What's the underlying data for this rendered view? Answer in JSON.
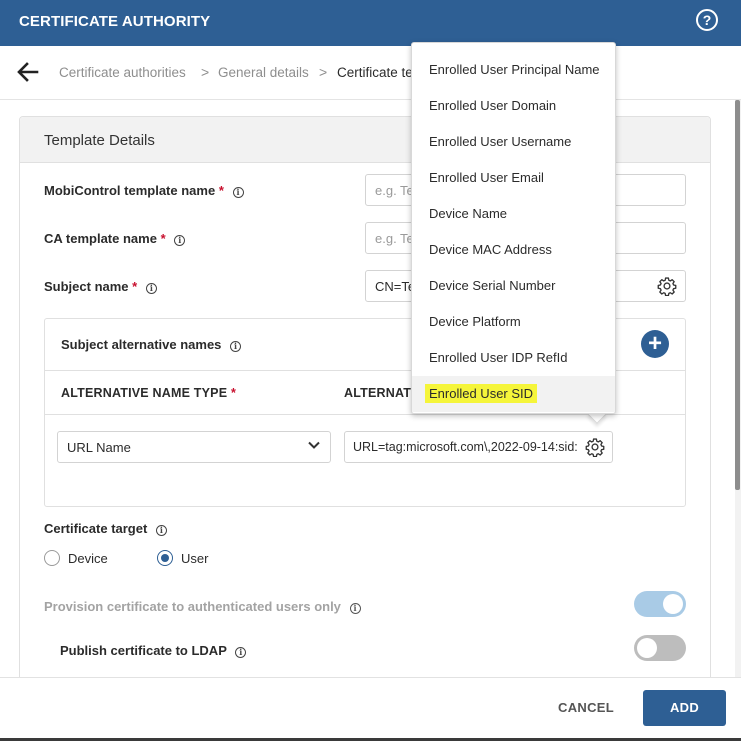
{
  "header": {
    "title": "CERTIFICATE AUTHORITY",
    "help_glyph": "?"
  },
  "breadcrumb": {
    "items": [
      "Certificate authorities",
      "General details",
      "Certificate te"
    ],
    "separator": ">"
  },
  "card": {
    "title": "Template Details",
    "mobicontrol_template": {
      "label": "MobiControl template name",
      "placeholder": "e.g. Te"
    },
    "ca_template": {
      "label": "CA template name",
      "placeholder": "e.g. Te"
    },
    "subject_name": {
      "label": "Subject name",
      "value": "CN=Te"
    },
    "san": {
      "title": "Subject alternative names",
      "add_glyph": "+",
      "col_type": "ALTERNATIVE NAME TYPE",
      "col_value": "ALTERNATIVE",
      "row": {
        "type": "URL Name",
        "value": "URL=tag:microsoft.com\\,2022-09-14:sid:"
      }
    },
    "certificate_target": {
      "label": "Certificate target",
      "options": [
        "Device",
        "User"
      ],
      "selected": "User"
    },
    "provision": {
      "label": "Provision certificate to authenticated users only",
      "on": true,
      "disabled": true
    },
    "publish_ldap": {
      "label": "Publish certificate to LDAP",
      "on": false
    }
  },
  "required_mark": "*",
  "info_glyph": "i",
  "footer": {
    "cancel": "CANCEL",
    "add": "ADD"
  },
  "variable_menu": {
    "items": [
      "Enrolled User Principal Name",
      "Enrolled User Domain",
      "Enrolled User Username",
      "Enrolled User Email",
      "Device Name",
      "Device MAC Address",
      "Device Serial Number",
      "Device Platform",
      "Enrolled User IDP RefId",
      "Enrolled User SID"
    ],
    "highlighted": "Enrolled User SID"
  },
  "colors": {
    "primary": "#2e5f94",
    "required": "#c8102e",
    "highlight": "#f5f53a",
    "toggle_on_disabled": "#a9cbe6",
    "toggle_off": "#bdbdbd"
  }
}
